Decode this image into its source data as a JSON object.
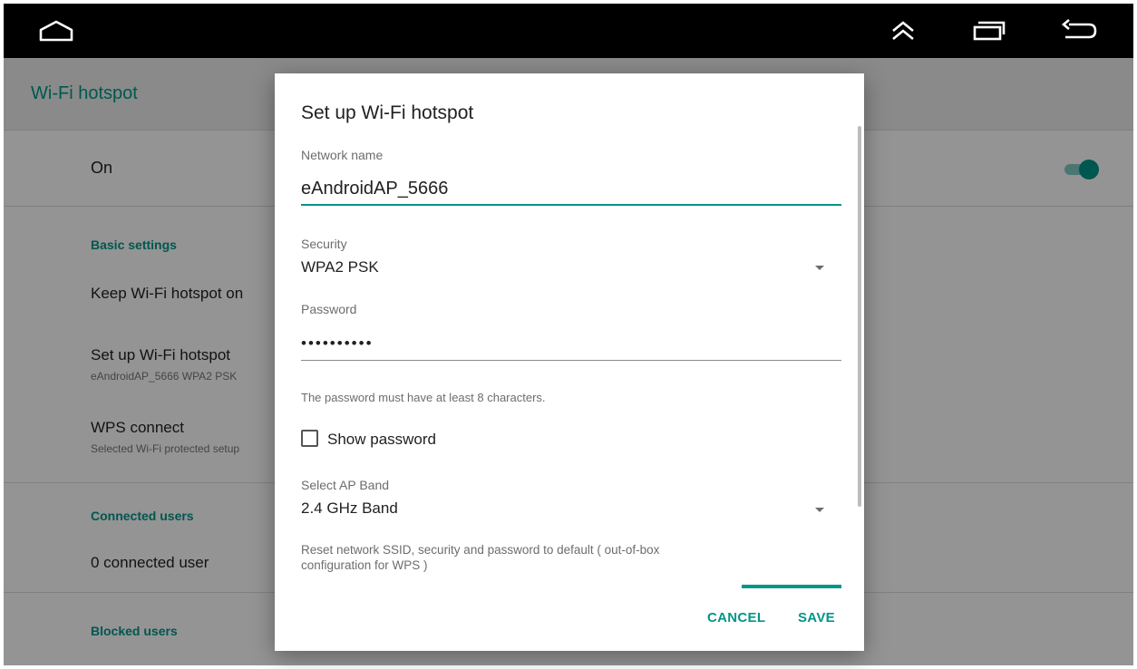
{
  "navbar": {
    "home_icon": "home-icon",
    "up_icon": "double-chevron-up-icon",
    "recents_icon": "recents-icon",
    "back_icon": "back-icon"
  },
  "settings": {
    "title": "Wi-Fi hotspot",
    "on_label": "On",
    "toggle_on": true,
    "basic_settings_label": "Basic settings",
    "keep_on_label": "Keep Wi-Fi hotspot on",
    "setup_label": "Set up Wi-Fi hotspot",
    "setup_summary": "eAndroidAP_5666 WPA2 PSK",
    "wps_label": "WPS connect",
    "wps_summary": "Selected Wi-Fi protected setup",
    "connected_users_label": "Connected users",
    "connected_count_label": "0 connected user",
    "blocked_users_label": "Blocked users"
  },
  "dialog": {
    "title": "Set up Wi-Fi hotspot",
    "network_name_label": "Network name",
    "network_name_value": "eAndroidAP_5666",
    "security_label": "Security",
    "security_value": "WPA2 PSK",
    "password_label": "Password",
    "password_value": "••••••••••",
    "password_hint": "The password must have at least 8 characters.",
    "show_password_label": "Show password",
    "show_password_checked": false,
    "ap_band_label": "Select AP Band",
    "ap_band_value": "2.4 GHz Band",
    "reset_text_line1": "Reset network SSID, security and password to default ( out-of-box",
    "reset_text_line2": "configuration for WPS )",
    "cancel_label": "CANCEL",
    "save_label": "SAVE"
  },
  "colors": {
    "accent": "#009688",
    "navbar": "#000000",
    "scrim": "rgba(0,0,0,0.42)"
  }
}
